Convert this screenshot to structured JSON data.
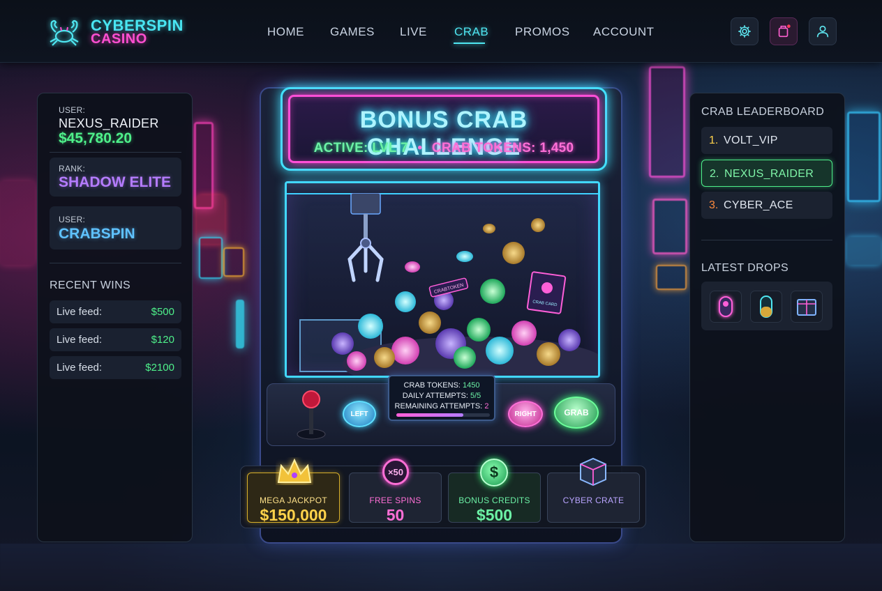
{
  "brand": {
    "line1": "CYBERSPIN",
    "line2": "CASINO",
    "logo_icon": "crab-icon"
  },
  "nav": {
    "links": [
      "HOME",
      "GAMES",
      "LIVE",
      "CRAB",
      "PROMOS",
      "ACCOUNT"
    ],
    "active": "CRAB",
    "icons": [
      "gear-icon",
      "notification-icon",
      "user-icon"
    ]
  },
  "left_panel": {
    "user_label": "USER:",
    "username": "NEXUS_RAIDER",
    "balance": "$45,780.20",
    "rank_label": "RANK:",
    "rank": "SHADOW ELITE",
    "user2_label": "USER:",
    "user2": "CRABSPIN",
    "recent_wins_title": "RECENT WINS",
    "recent_wins": [
      {
        "label": "Live feed:",
        "amount": "$500"
      },
      {
        "label": "Live feed:",
        "amount": "$120"
      },
      {
        "label": "Live feed:",
        "amount": "$2100"
      }
    ]
  },
  "machine": {
    "title": "BONUS CRAB CHALLENGE",
    "subtitle_active": "ACTIVE: LVL 7",
    "subtitle_sep": "•",
    "subtitle_tokens": "CRAB TOKENS: 1,450",
    "buttons": {
      "left": "LEFT",
      "right": "RIGHT",
      "grab": "GRAB"
    },
    "stats": {
      "tokens_label": "CRAB TOKENS:",
      "tokens": "1450",
      "daily_label": "DAILY ATTEMPTS:",
      "daily": "5/5",
      "remaining_label": "REMAINING ATTEMPTS:",
      "remaining": "2",
      "progress": 0.72
    },
    "crate_label": "CRABTOKEN",
    "card_label": "CRAB CARD"
  },
  "prizes": [
    {
      "icon": "crown-icon",
      "label": "MEGA JACKPOT",
      "value": "$150,000"
    },
    {
      "icon": "free-spins-icon",
      "badge": "×50",
      "label": "FREE SPINS",
      "value": "50"
    },
    {
      "icon": "dollar-coin-icon",
      "badge": "$",
      "label": "BONUS CREDITS",
      "value": "$500"
    },
    {
      "icon": "crate-icon",
      "label": "CYBER CRATE",
      "value": ""
    }
  ],
  "right_panel": {
    "leaderboard_title": "CRAB LEADERBOARD",
    "leaderboard": [
      {
        "rank": "1.",
        "user": "VOLT_VIP"
      },
      {
        "rank": "2.",
        "user": "NEXUS_RAIDER"
      },
      {
        "rank": "3.",
        "user": "CYBER_ACE"
      }
    ],
    "drops_title": "LATEST DROPS",
    "drops": [
      "capsule-crab-icon",
      "capsule-gem-icon",
      "cyber-crate-icon"
    ]
  },
  "colors": {
    "cyan": "#4fe7f2",
    "magenta": "#ff4fd1",
    "green": "#4ef08a",
    "gold": "#ffd24a",
    "purple": "#b57cff",
    "blue": "#5fc2ff"
  }
}
